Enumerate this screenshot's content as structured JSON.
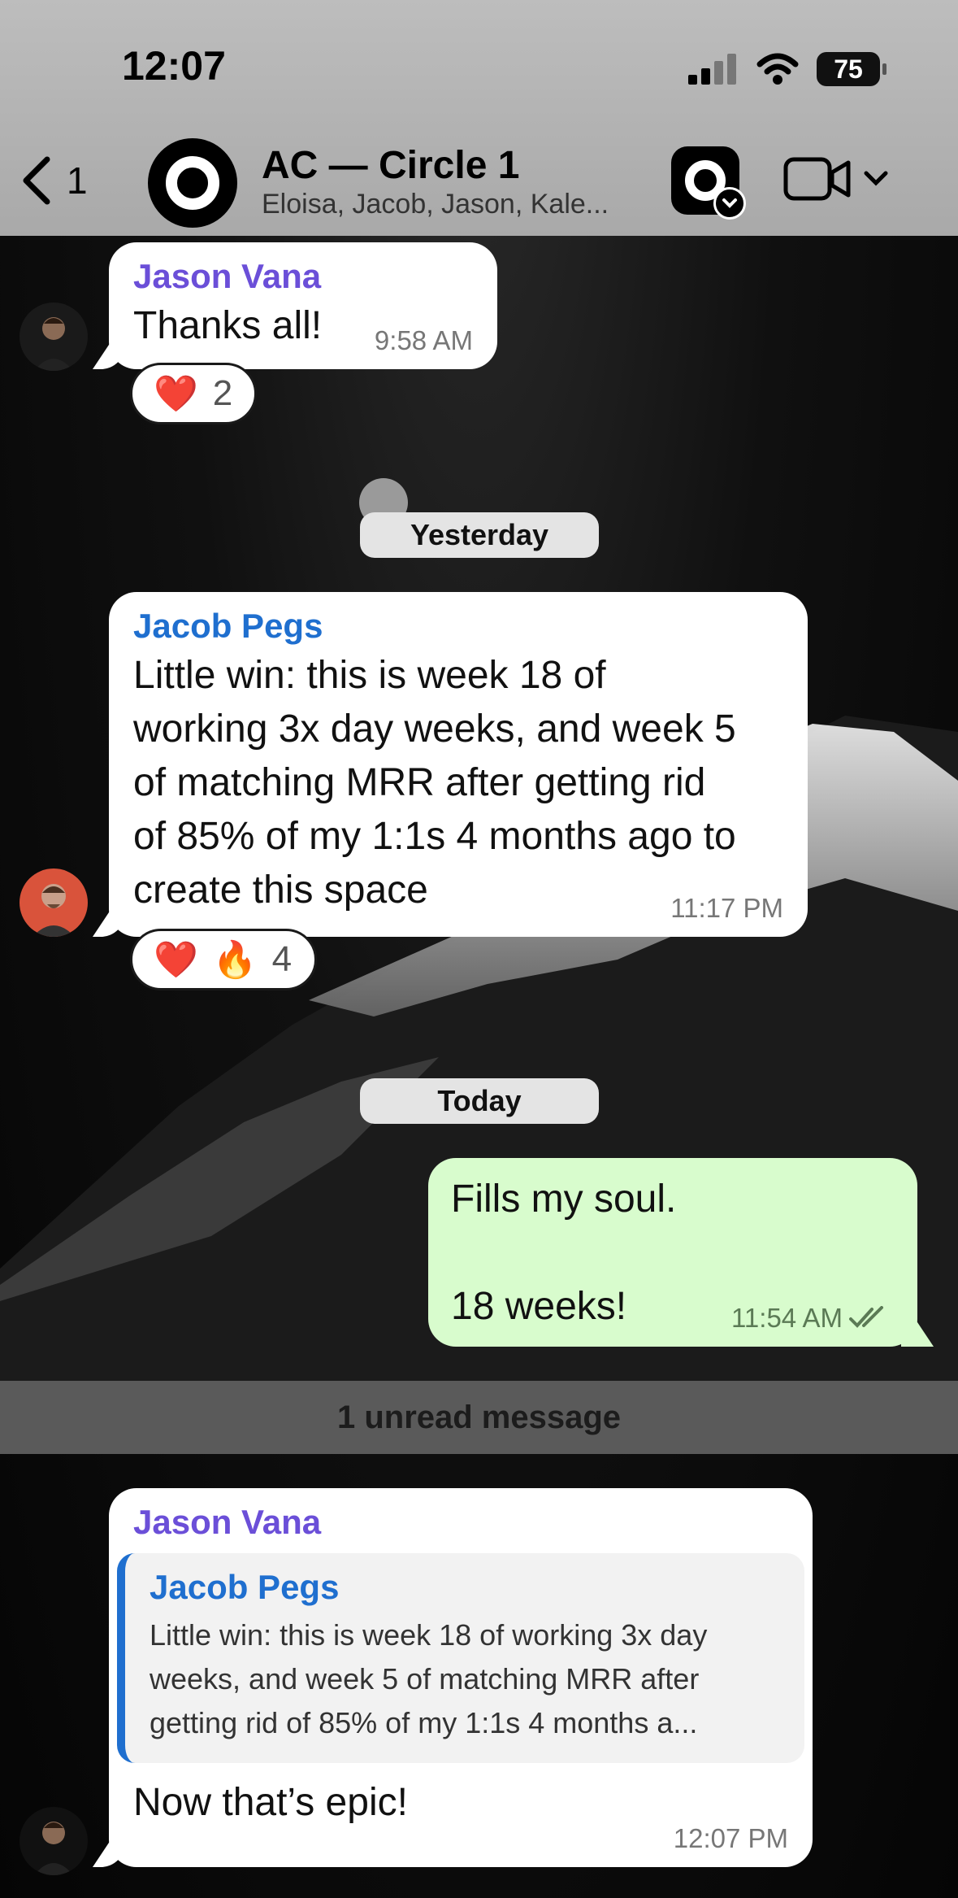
{
  "status_bar": {
    "time": "12:07",
    "battery": "75"
  },
  "header": {
    "back_count": "1",
    "title": "AC — Circle 1",
    "members": "Eloisa, Jacob, Jason, Kale..."
  },
  "messages": [
    {
      "sender": "Jason Vana",
      "text": "Thanks all!",
      "time": "9:58 AM",
      "reactions": {
        "emojis": [
          "❤️"
        ],
        "count": "2"
      }
    },
    {
      "sender": "Jacob Pegs",
      "text": "Little win: this is week 18 of\nworking 3x day weeks, and week 5\nof matching MRR after getting rid\nof 85% of my 1:1s 4 months ago to\ncreate this space",
      "time": "11:17 PM",
      "reactions": {
        "emojis": [
          "❤️",
          "🔥"
        ],
        "count": "4"
      }
    },
    {
      "text": "Fills my soul.\n\n18 weeks!",
      "time": "11:54 AM"
    },
    {
      "sender": "Jason Vana",
      "reply": {
        "sender": "Jacob Pegs",
        "text": "Little win: this is week 18 of working 3x day weeks, and week 5 of matching MRR after getting rid of 85% of my 1:1s 4 months a..."
      },
      "text": "Now that’s epic!",
      "time": "12:07 PM"
    }
  ],
  "dividers": {
    "yesterday": "Yesterday",
    "today": "Today"
  },
  "unread_label": "1 unread message",
  "colors": {
    "outgoing": "#d8fccd",
    "purple_sender": "#6b4fd8",
    "blue_sender": "#1f6fcf"
  }
}
